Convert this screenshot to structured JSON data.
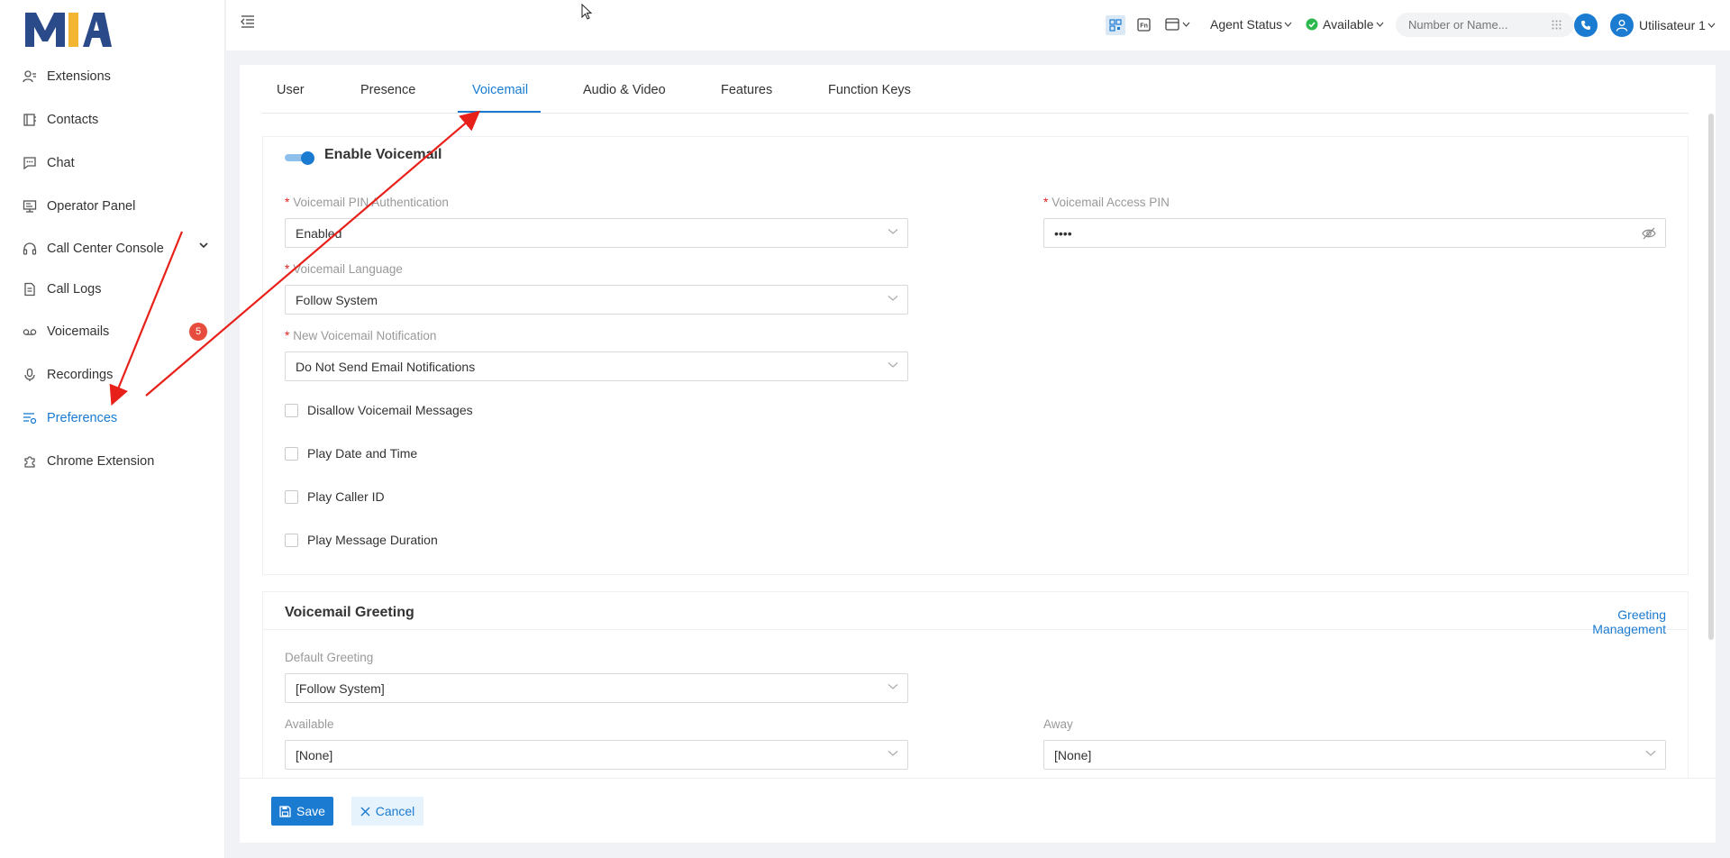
{
  "brand": {
    "logo_text": "MIA"
  },
  "sidebar": {
    "items": [
      {
        "label": "Extensions",
        "icon": "user-list-icon"
      },
      {
        "label": "Contacts",
        "icon": "contacts-book-icon"
      },
      {
        "label": "Chat",
        "icon": "chat-icon"
      },
      {
        "label": "Operator Panel",
        "icon": "monitor-icon"
      },
      {
        "label": "Call Center Console",
        "icon": "headset-icon"
      },
      {
        "label": "Call Logs",
        "icon": "document-icon"
      },
      {
        "label": "Voicemails",
        "icon": "voicemail-icon"
      },
      {
        "label": "Recordings",
        "icon": "microphone-icon"
      },
      {
        "label": "Preferences",
        "icon": "settings-list-icon"
      },
      {
        "label": "Chrome Extension",
        "icon": "puzzle-icon"
      }
    ],
    "voicemail_badge": "5"
  },
  "topbar": {
    "agent_status": "Agent Status",
    "presence": "Available",
    "search_placeholder": "Number or Name...",
    "user_name": "Utilisateur 1"
  },
  "tabs": [
    "User",
    "Presence",
    "Voicemail",
    "Audio & Video",
    "Features",
    "Function Keys"
  ],
  "voicemail": {
    "enable_label": "Enable Voicemail",
    "enabled": true,
    "pin_auth_label": "Voicemail PIN Authentication",
    "pin_auth_value": "Enabled",
    "access_pin_label": "Voicemail Access PIN",
    "access_pin_value": "••••",
    "language_label": "Voicemail Language",
    "language_value": "Follow System",
    "notification_label": "New Voicemail Notification",
    "notification_value": "Do Not Send Email Notifications",
    "checkboxes": [
      "Disallow Voicemail Messages",
      "Play Date and Time",
      "Play Caller ID",
      "Play Message Duration"
    ]
  },
  "greeting": {
    "title": "Voicemail Greeting",
    "manage_link": "Greeting Management",
    "default_label": "Default Greeting",
    "default_value": "[Follow System]",
    "available_label": "Available",
    "available_value": "[None]",
    "away_label": "Away",
    "away_value": "[None]"
  },
  "footer": {
    "save": "Save",
    "cancel": "Cancel"
  },
  "colors": {
    "accent": "#1a7bd1",
    "badge": "#e74c3c",
    "available": "#2db84d",
    "required": "#e02020",
    "annotation_arrow": "#e8201a"
  }
}
